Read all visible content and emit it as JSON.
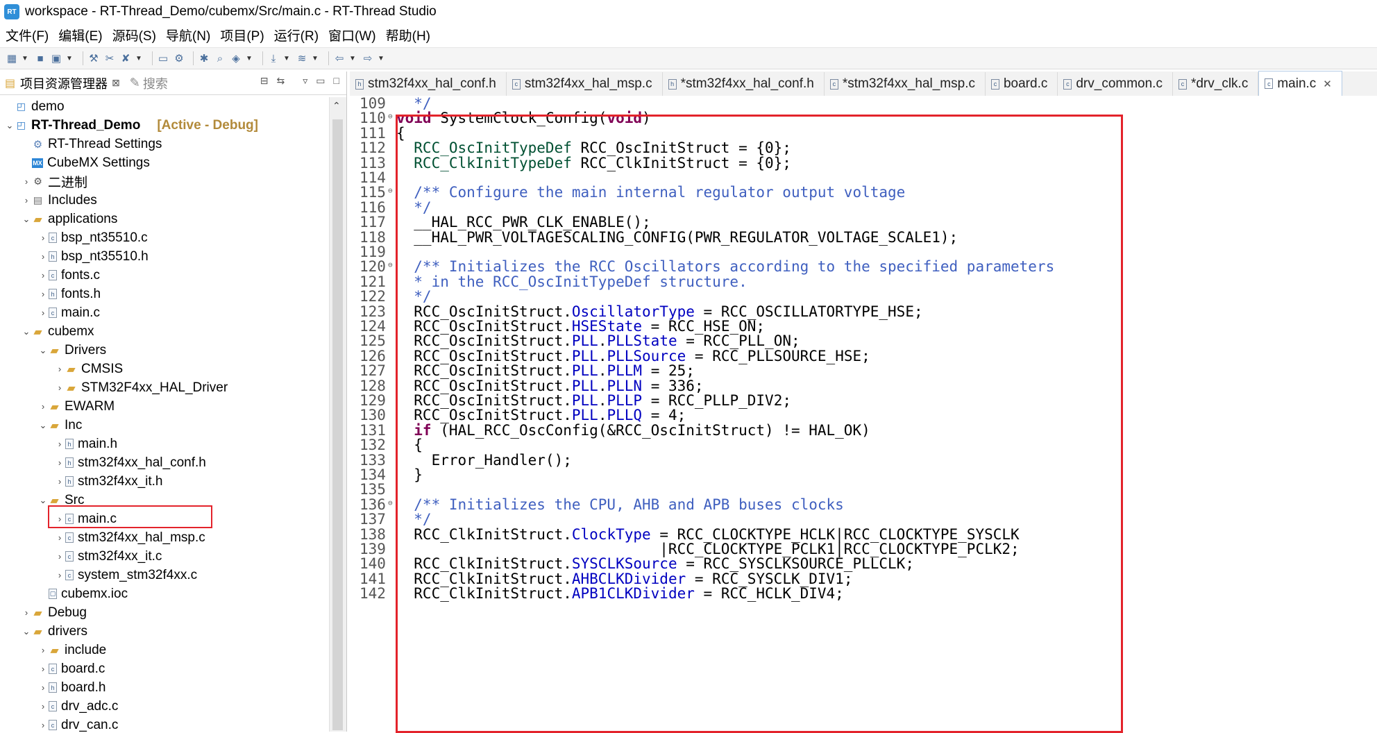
{
  "window": {
    "title": "workspace - RT-Thread_Demo/cubemx/Src/main.c - RT-Thread Studio",
    "icon_text": "RT"
  },
  "menu": [
    "文件(F)",
    "编辑(E)",
    "源码(S)",
    "导航(N)",
    "项目(P)",
    "运行(R)",
    "窗口(W)",
    "帮助(H)"
  ],
  "toolbar": {
    "icons": [
      "new-icon",
      "save-icon",
      "save-all-icon",
      "build-icon",
      "debug-icon",
      "clean-icon",
      "terminal-icon",
      "settings-icon",
      "bug-icon",
      "search-icon",
      "layers-icon",
      "download-icon",
      "stack-icon",
      "back-icon",
      "forward-icon"
    ]
  },
  "explorer": {
    "tab_label": "项目资源管理器",
    "search_tab_label": "搜索",
    "close_glyph": "⊠",
    "tree": [
      {
        "label": "demo",
        "icon": "project-icon",
        "indent": 0,
        "arrow": ""
      },
      {
        "label": "RT-Thread_Demo",
        "icon": "project-icon",
        "indent": 0,
        "arrow": "v",
        "bold": true,
        "suffix": "[Active - Debug]"
      },
      {
        "label": "RT-Thread Settings",
        "icon": "rt-settings-icon",
        "indent": 1,
        "arrow": ""
      },
      {
        "label": "CubeMX Settings",
        "icon": "cubemx-icon",
        "indent": 1,
        "arrow": ""
      },
      {
        "label": "二进制",
        "icon": "binary-icon",
        "indent": 1,
        "arrow": ">"
      },
      {
        "label": "Includes",
        "icon": "includes-icon",
        "indent": 1,
        "arrow": ">"
      },
      {
        "label": "applications",
        "icon": "folder-icon",
        "indent": 1,
        "arrow": "v"
      },
      {
        "label": "bsp_nt35510.c",
        "icon": "c-file-icon",
        "indent": 2,
        "arrow": ">"
      },
      {
        "label": "bsp_nt35510.h",
        "icon": "h-file-icon",
        "indent": 2,
        "arrow": ">"
      },
      {
        "label": "fonts.c",
        "icon": "c-file-icon",
        "indent": 2,
        "arrow": ">"
      },
      {
        "label": "fonts.h",
        "icon": "h-file-icon",
        "indent": 2,
        "arrow": ">"
      },
      {
        "label": "main.c",
        "icon": "c-file-icon",
        "indent": 2,
        "arrow": ">"
      },
      {
        "label": "cubemx",
        "icon": "folder-icon",
        "indent": 1,
        "arrow": "v"
      },
      {
        "label": "Drivers",
        "icon": "folder-icon",
        "indent": 2,
        "arrow": "v"
      },
      {
        "label": "CMSIS",
        "icon": "folder-icon",
        "indent": 3,
        "arrow": ">"
      },
      {
        "label": "STM32F4xx_HAL_Driver",
        "icon": "folder-icon",
        "indent": 3,
        "arrow": ">"
      },
      {
        "label": "EWARM",
        "icon": "folder-icon",
        "indent": 2,
        "arrow": ">"
      },
      {
        "label": "Inc",
        "icon": "folder-icon",
        "indent": 2,
        "arrow": "v"
      },
      {
        "label": "main.h",
        "icon": "h-file-icon",
        "indent": 3,
        "arrow": ">"
      },
      {
        "label": "stm32f4xx_hal_conf.h",
        "icon": "h-file-icon",
        "indent": 3,
        "arrow": ">"
      },
      {
        "label": "stm32f4xx_it.h",
        "icon": "h-file-icon",
        "indent": 3,
        "arrow": ">"
      },
      {
        "label": "Src",
        "icon": "folder-icon",
        "indent": 2,
        "arrow": "v"
      },
      {
        "label": "main.c",
        "icon": "c-file-icon",
        "indent": 3,
        "arrow": ">",
        "highlighted": true
      },
      {
        "label": "stm32f4xx_hal_msp.c",
        "icon": "c-file-icon",
        "indent": 3,
        "arrow": ">"
      },
      {
        "label": "stm32f4xx_it.c",
        "icon": "c-file-icon",
        "indent": 3,
        "arrow": ">"
      },
      {
        "label": "system_stm32f4xx.c",
        "icon": "c-file-icon",
        "indent": 3,
        "arrow": ">"
      },
      {
        "label": "cubemx.ioc",
        "icon": "file-icon",
        "indent": 2,
        "arrow": ""
      },
      {
        "label": "Debug",
        "icon": "folder-icon",
        "indent": 1,
        "arrow": ">"
      },
      {
        "label": "drivers",
        "icon": "folder-icon",
        "indent": 1,
        "arrow": "v"
      },
      {
        "label": "include",
        "icon": "folder-icon",
        "indent": 2,
        "arrow": ">"
      },
      {
        "label": "board.c",
        "icon": "c-file-icon",
        "indent": 2,
        "arrow": ">"
      },
      {
        "label": "board.h",
        "icon": "h-file-icon",
        "indent": 2,
        "arrow": ">"
      },
      {
        "label": "drv_adc.c",
        "icon": "c-file-icon",
        "indent": 2,
        "arrow": ">"
      },
      {
        "label": "drv_can.c",
        "icon": "c-file-icon",
        "indent": 2,
        "arrow": ">"
      }
    ]
  },
  "editor_tabs": [
    {
      "label": "stm32f4xx_hal_conf.h",
      "kind": "h"
    },
    {
      "label": "stm32f4xx_hal_msp.c",
      "kind": "c"
    },
    {
      "label": "*stm32f4xx_hal_conf.h",
      "kind": "h"
    },
    {
      "label": "*stm32f4xx_hal_msp.c",
      "kind": "c"
    },
    {
      "label": "board.c",
      "kind": "c"
    },
    {
      "label": "drv_common.c",
      "kind": "c"
    },
    {
      "label": "*drv_clk.c",
      "kind": "c"
    },
    {
      "label": "main.c",
      "kind": "c",
      "active": true
    }
  ],
  "code_lines": [
    {
      "n": "109",
      "fold": false,
      "tokens": [
        [
          "cm",
          "  */"
        ]
      ]
    },
    {
      "n": "110",
      "fold": true,
      "tokens": [
        [
          "kw",
          "void"
        ],
        [
          "",
          " SystemClock_Config("
        ],
        [
          "kw",
          "void"
        ],
        [
          "",
          ")"
        ]
      ]
    },
    {
      "n": "111",
      "fold": false,
      "tokens": [
        [
          "",
          "{"
        ]
      ]
    },
    {
      "n": "112",
      "fold": false,
      "tokens": [
        [
          "ty",
          "  RCC_OscInitTypeDef"
        ],
        [
          "",
          " RCC_OscInitStruct = {0};"
        ]
      ]
    },
    {
      "n": "113",
      "fold": false,
      "tokens": [
        [
          "ty",
          "  RCC_ClkInitTypeDef"
        ],
        [
          "",
          " RCC_ClkInitStruct = {0};"
        ]
      ]
    },
    {
      "n": "114",
      "fold": false,
      "tokens": []
    },
    {
      "n": "115",
      "fold": true,
      "tokens": [
        [
          "cm",
          "  /** Configure the main internal regulator output voltage"
        ]
      ]
    },
    {
      "n": "116",
      "fold": false,
      "tokens": [
        [
          "cm",
          "  */"
        ]
      ]
    },
    {
      "n": "117",
      "fold": false,
      "tokens": [
        [
          "",
          "  __HAL_RCC_PWR_CLK_ENABLE();"
        ]
      ]
    },
    {
      "n": "118",
      "fold": false,
      "tokens": [
        [
          "",
          "  __HAL_PWR_VOLTAGESCALING_CONFIG(PWR_REGULATOR_VOLTAGE_SCALE1);"
        ]
      ]
    },
    {
      "n": "119",
      "fold": false,
      "tokens": []
    },
    {
      "n": "120",
      "fold": true,
      "tokens": [
        [
          "cm",
          "  /** Initializes the RCC Oscillators according to the specified parameters"
        ]
      ]
    },
    {
      "n": "121",
      "fold": false,
      "tokens": [
        [
          "cm",
          "  * in the RCC_OscInitTypeDef structure."
        ]
      ]
    },
    {
      "n": "122",
      "fold": false,
      "tokens": [
        [
          "cm",
          "  */"
        ]
      ]
    },
    {
      "n": "123",
      "fold": false,
      "tokens": [
        [
          "",
          "  RCC_OscInitStruct."
        ],
        [
          "fl",
          "OscillatorType"
        ],
        [
          "",
          " = RCC_OSCILLATORTYPE_HSE;"
        ]
      ]
    },
    {
      "n": "124",
      "fold": false,
      "tokens": [
        [
          "",
          "  RCC_OscInitStruct."
        ],
        [
          "fl",
          "HSEState"
        ],
        [
          "",
          " = RCC_HSE_ON;"
        ]
      ]
    },
    {
      "n": "125",
      "fold": false,
      "tokens": [
        [
          "",
          "  RCC_OscInitStruct."
        ],
        [
          "fl",
          "PLL"
        ],
        [
          "",
          "."
        ],
        [
          "fl",
          "PLLState"
        ],
        [
          "",
          " = RCC_PLL_ON;"
        ]
      ]
    },
    {
      "n": "126",
      "fold": false,
      "tokens": [
        [
          "",
          "  RCC_OscInitStruct."
        ],
        [
          "fl",
          "PLL"
        ],
        [
          "",
          "."
        ],
        [
          "fl",
          "PLLSource"
        ],
        [
          "",
          " = RCC_PLLSOURCE_HSE;"
        ]
      ]
    },
    {
      "n": "127",
      "fold": false,
      "tokens": [
        [
          "",
          "  RCC_OscInitStruct."
        ],
        [
          "fl",
          "PLL"
        ],
        [
          "",
          "."
        ],
        [
          "fl",
          "PLLM"
        ],
        [
          "",
          " = 25;"
        ]
      ]
    },
    {
      "n": "128",
      "fold": false,
      "tokens": [
        [
          "",
          "  RCC_OscInitStruct."
        ],
        [
          "fl",
          "PLL"
        ],
        [
          "",
          "."
        ],
        [
          "fl",
          "PLLN"
        ],
        [
          "",
          " = 336;"
        ]
      ]
    },
    {
      "n": "129",
      "fold": false,
      "tokens": [
        [
          "",
          "  RCC_OscInitStruct."
        ],
        [
          "fl",
          "PLL"
        ],
        [
          "",
          "."
        ],
        [
          "fl",
          "PLLP"
        ],
        [
          "",
          " = RCC_PLLP_DIV2;"
        ]
      ]
    },
    {
      "n": "130",
      "fold": false,
      "tokens": [
        [
          "",
          "  RCC_OscInitStruct."
        ],
        [
          "fl",
          "PLL"
        ],
        [
          "",
          "."
        ],
        [
          "fl",
          "PLLQ"
        ],
        [
          "",
          " = 4;"
        ]
      ]
    },
    {
      "n": "131",
      "fold": false,
      "tokens": [
        [
          "kw",
          "  if"
        ],
        [
          "",
          " (HAL_RCC_OscConfig(&RCC_OscInitStruct) != HAL_OK)"
        ]
      ]
    },
    {
      "n": "132",
      "fold": false,
      "tokens": [
        [
          "",
          "  {"
        ]
      ]
    },
    {
      "n": "133",
      "fold": false,
      "tokens": [
        [
          "",
          "    Error_Handler();"
        ]
      ]
    },
    {
      "n": "134",
      "fold": false,
      "tokens": [
        [
          "",
          "  }"
        ]
      ]
    },
    {
      "n": "135",
      "fold": false,
      "tokens": []
    },
    {
      "n": "136",
      "fold": true,
      "tokens": [
        [
          "cm",
          "  /** Initializes the CPU, AHB and APB buses clocks"
        ]
      ]
    },
    {
      "n": "137",
      "fold": false,
      "tokens": [
        [
          "cm",
          "  */"
        ]
      ]
    },
    {
      "n": "138",
      "fold": false,
      "tokens": [
        [
          "",
          "  RCC_ClkInitStruct."
        ],
        [
          "fl",
          "ClockType"
        ],
        [
          "",
          " = RCC_CLOCKTYPE_HCLK|RCC_CLOCKTYPE_SYSCLK"
        ]
      ]
    },
    {
      "n": "139",
      "fold": false,
      "tokens": [
        [
          "",
          "                              |RCC_CLOCKTYPE_PCLK1|RCC_CLOCKTYPE_PCLK2;"
        ]
      ]
    },
    {
      "n": "140",
      "fold": false,
      "tokens": [
        [
          "",
          "  RCC_ClkInitStruct."
        ],
        [
          "fl",
          "SYSCLKSource"
        ],
        [
          "",
          " = RCC_SYSCLKSOURCE_PLLCLK;"
        ]
      ]
    },
    {
      "n": "141",
      "fold": false,
      "tokens": [
        [
          "",
          "  RCC_ClkInitStruct."
        ],
        [
          "fl",
          "AHBCLKDivider"
        ],
        [
          "",
          " = RCC_SYSCLK_DIV1;"
        ]
      ]
    },
    {
      "n": "142",
      "fold": false,
      "tokens": [
        [
          "",
          "  RCC_ClkInitStruct."
        ],
        [
          "fl",
          "APB1CLKDivider"
        ],
        [
          "",
          " = RCC_HCLK_DIV4;"
        ]
      ]
    }
  ],
  "colors": {
    "highlight_box": "#e3232b",
    "keyword": "#7f0055",
    "comment": "#3f5fbf",
    "field": "#0000c0",
    "type": "#005032"
  }
}
